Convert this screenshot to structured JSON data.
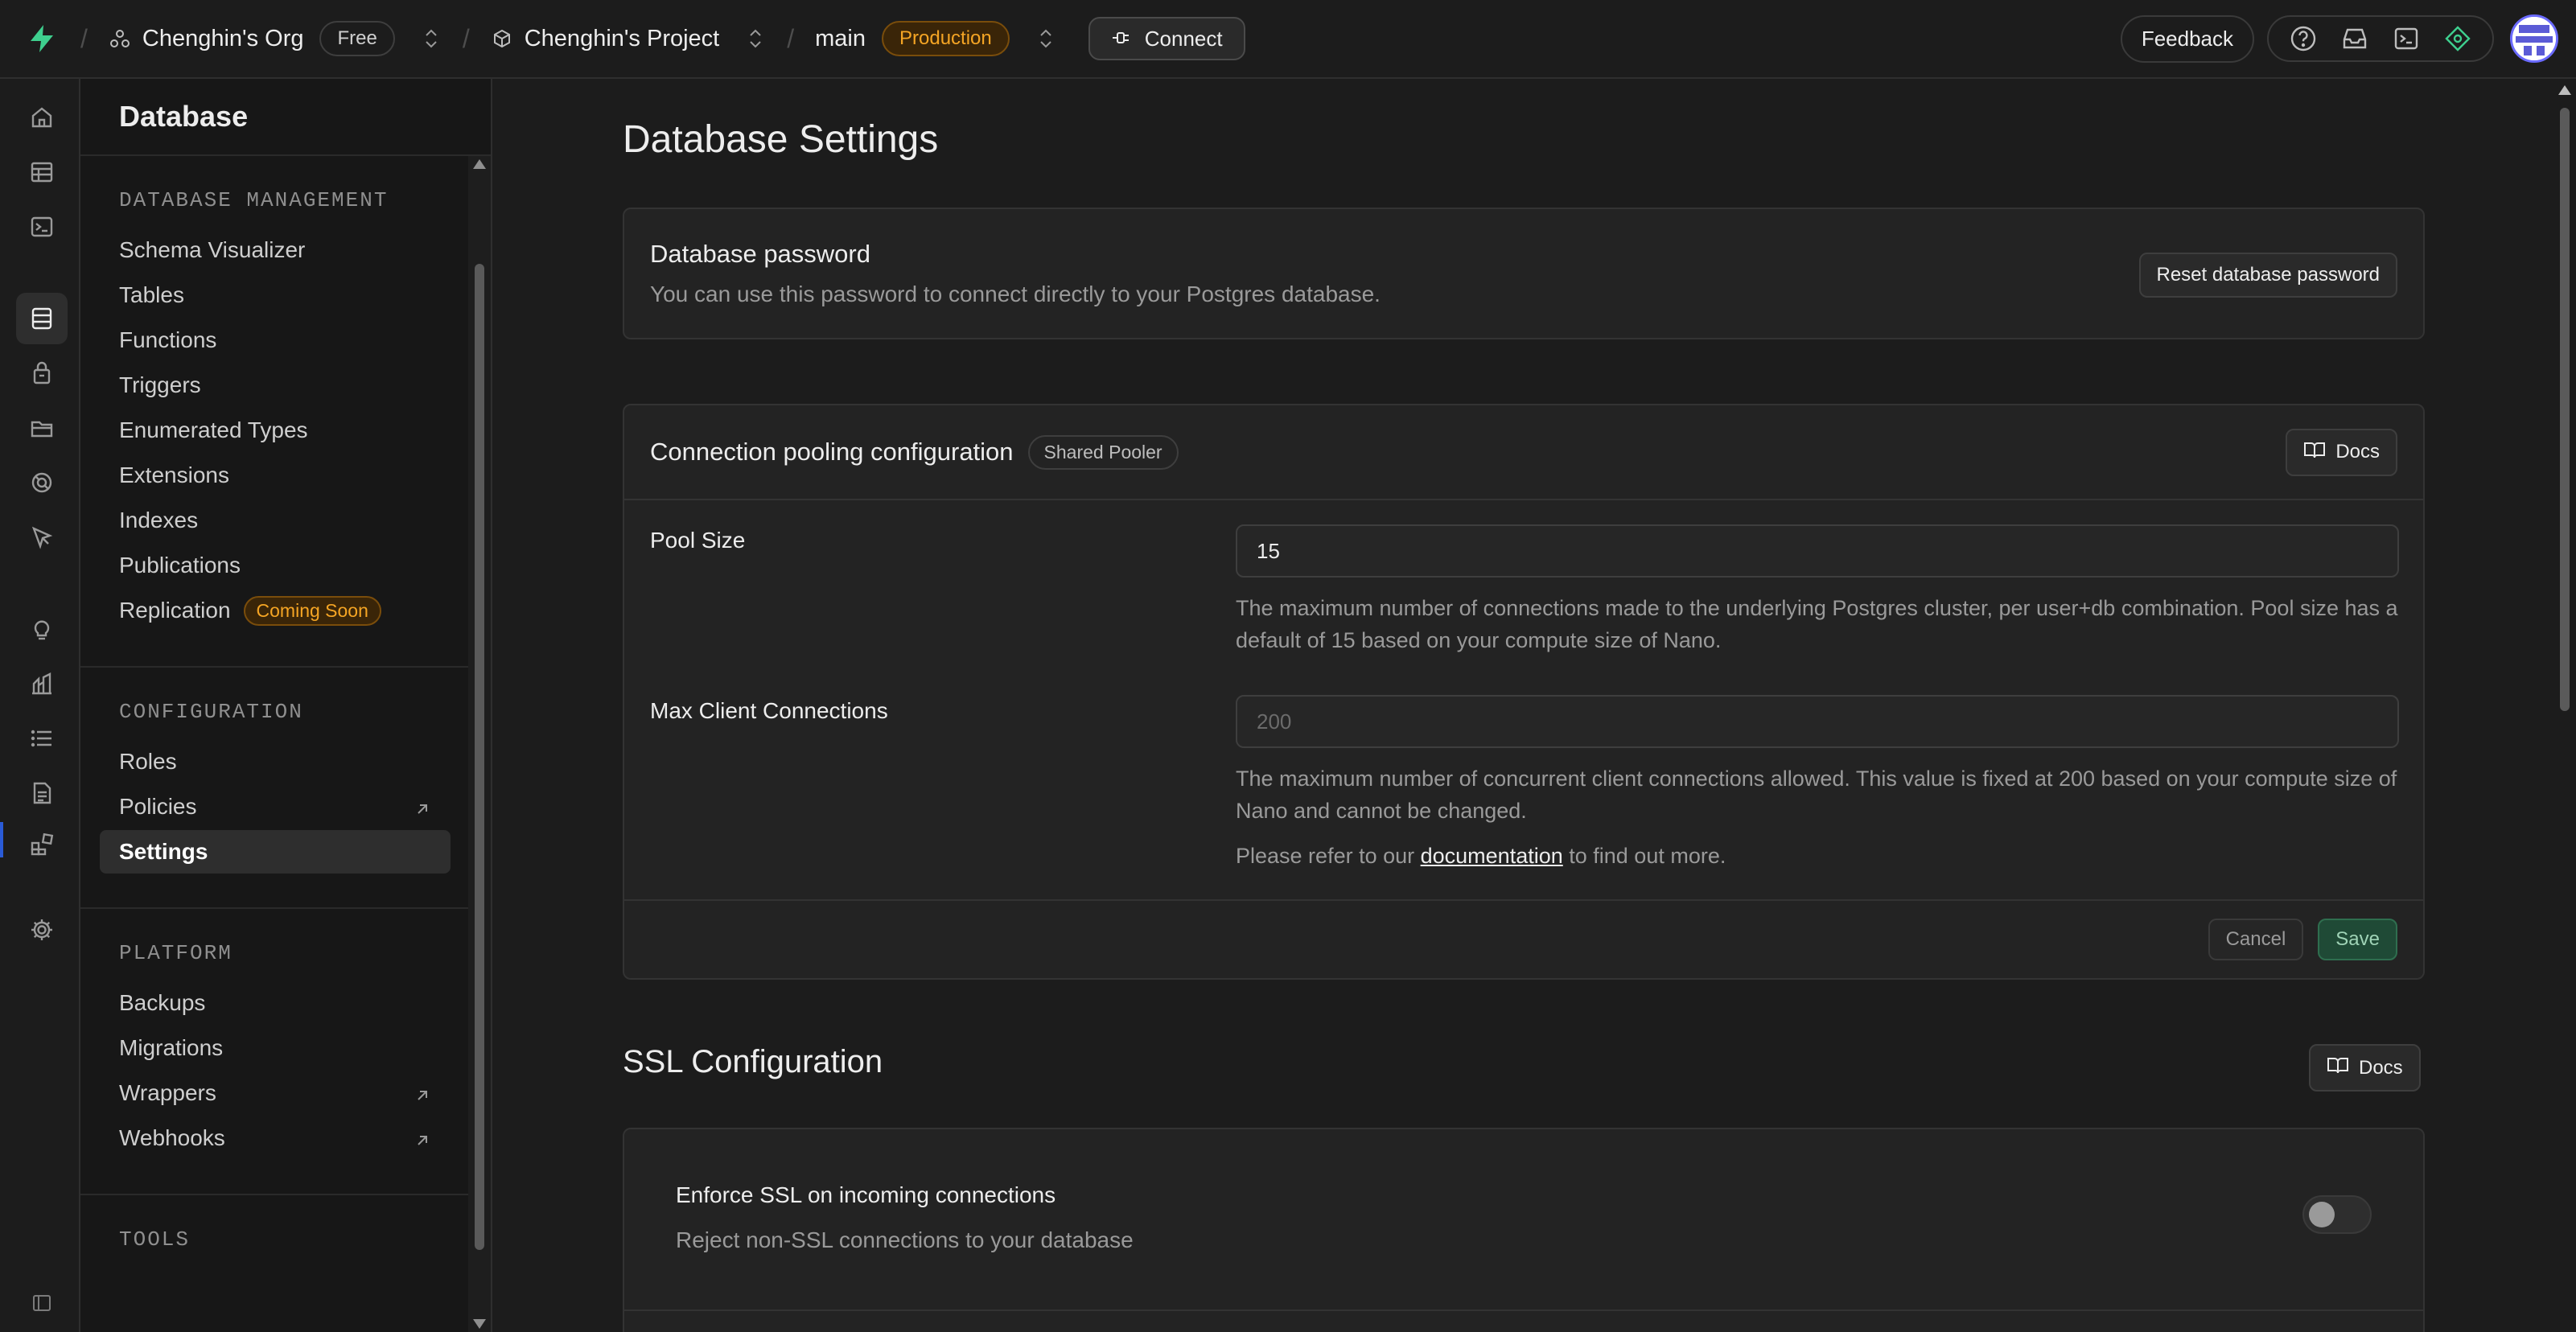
{
  "topbar": {
    "org_name": "Chenghin's Org",
    "org_plan": "Free",
    "project_name": "Chenghin's Project",
    "branch_name": "main",
    "branch_env": "Production",
    "connect_label": "Connect",
    "feedback_label": "Feedback",
    "icons": [
      "help-icon",
      "inbox-icon",
      "terminal-icon",
      "assistant-icon"
    ]
  },
  "rail": {
    "items": [
      "home-icon",
      "table-editor-icon",
      "sql-editor-icon",
      "database-icon",
      "auth-icon",
      "storage-icon",
      "realtime-icon",
      "edge-functions-icon",
      "advisors-icon",
      "reports-icon",
      "logs-icon",
      "api-docs-icon",
      "integrations-icon",
      "settings-icon",
      "collapse-icon"
    ],
    "active": "database-icon"
  },
  "sidemenu": {
    "title": "Database",
    "sections": [
      {
        "heading": "DATABASE MANAGEMENT",
        "items": [
          {
            "label": "Schema Visualizer"
          },
          {
            "label": "Tables"
          },
          {
            "label": "Functions"
          },
          {
            "label": "Triggers"
          },
          {
            "label": "Enumerated Types"
          },
          {
            "label": "Extensions"
          },
          {
            "label": "Indexes"
          },
          {
            "label": "Publications"
          },
          {
            "label": "Replication",
            "badge": "Coming Soon"
          }
        ]
      },
      {
        "heading": "CONFIGURATION",
        "items": [
          {
            "label": "Roles"
          },
          {
            "label": "Policies",
            "external": true
          },
          {
            "label": "Settings",
            "active": true
          }
        ]
      },
      {
        "heading": "PLATFORM",
        "items": [
          {
            "label": "Backups"
          },
          {
            "label": "Migrations"
          },
          {
            "label": "Wrappers",
            "external": true
          },
          {
            "label": "Webhooks",
            "external": true
          }
        ]
      },
      {
        "heading": "TOOLS",
        "items": []
      }
    ]
  },
  "main": {
    "page_title": "Database Settings",
    "password_card": {
      "title": "Database password",
      "description": "You can use this password to connect directly to your Postgres database.",
      "reset_button": "Reset database password"
    },
    "pooling_card": {
      "title": "Connection pooling configuration",
      "badge": "Shared Pooler",
      "docs_button": "Docs",
      "pool_size_label": "Pool Size",
      "pool_size_value": "15",
      "pool_size_help": "The maximum number of connections made to the underlying Postgres cluster, per user+db combination. Pool size has a default of 15 based on your compute size of Nano.",
      "max_client_label": "Max Client Connections",
      "max_client_placeholder": "200",
      "max_client_help": "The maximum number of concurrent client connections allowed. This value is fixed at 200 based on your compute size of Nano and cannot be changed.",
      "refer_prefix": "Please refer to our ",
      "refer_link": "documentation",
      "refer_suffix": " to find out more.",
      "cancel_button": "Cancel",
      "save_button": "Save"
    },
    "ssl": {
      "title": "SSL Configuration",
      "docs_button": "Docs",
      "enforce_title": "Enforce SSL on incoming connections",
      "enforce_desc": "Reject non-SSL connections to your database",
      "enforce_enabled": false
    }
  },
  "colors": {
    "accent_green": "#3ecf8e",
    "production_amber": "#f5a524",
    "background": "#1c1c1c"
  }
}
